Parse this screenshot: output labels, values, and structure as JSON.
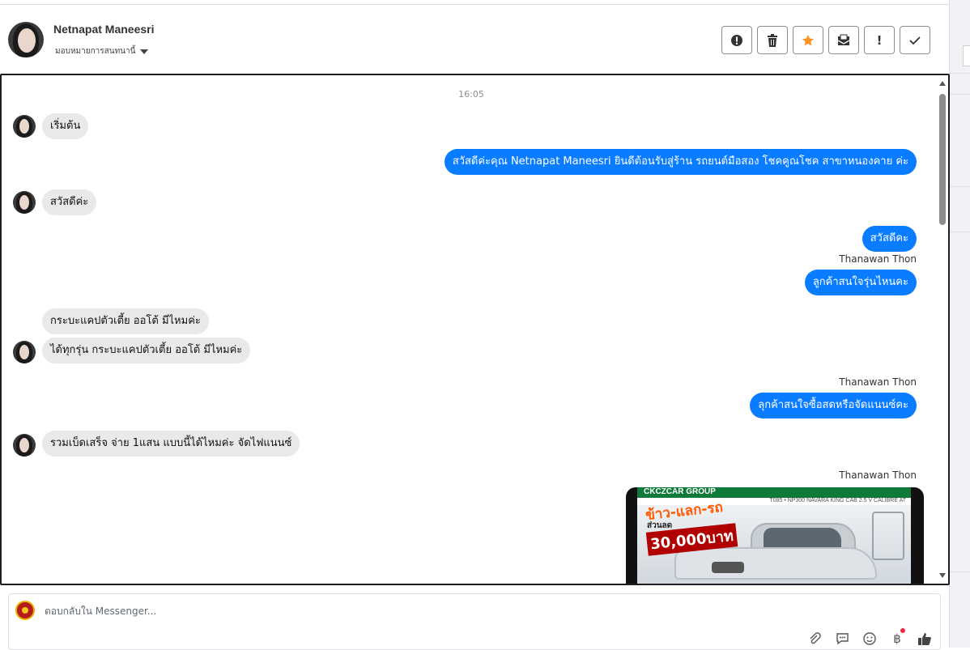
{
  "header": {
    "contact_name": "Netnapat Maneesri",
    "assign_label": "มอบหมายการสนทนานี้",
    "actions": [
      {
        "name": "spam-button",
        "icon": "alert-circle-icon"
      },
      {
        "name": "delete-button",
        "icon": "trash-icon"
      },
      {
        "name": "star-button",
        "icon": "star-icon",
        "color": "#f7931e"
      },
      {
        "name": "mark-unread-button",
        "icon": "envelope-icon"
      },
      {
        "name": "follow-up-button",
        "icon": "exclamation-icon"
      },
      {
        "name": "done-button",
        "icon": "check-icon"
      }
    ]
  },
  "conversation": {
    "time": "16:05",
    "messages": {
      "m1": "เริ่มต้น",
      "m2": "สวัสดีค่ะคุณ Netnapat Maneesri ยินดีต้อนรับสู่ร้าน รถยนต์มือสอง โชคคูณโชค สาขาหนองคาย ค่ะ",
      "m3": "สวัสดีค่ะ",
      "m4": "สวัสดีคะ",
      "m4_sender": "Thanawan Thon",
      "m5": "ลูกค้าสนใจรุ่นไหนคะ",
      "m6": "กระบะแคปตัวเตี้ย ออโต้ มีไหมค่ะ",
      "m7": "ได้ทุกรุ่น กระบะแคปตัวเตี้ย ออโต้ มีไหมค่ะ",
      "m8_sender": "Thanawan Thon",
      "m8": "ลุกค้าสนใจซื้อสดหรือจัดแนนซ์คะ",
      "m9": "รวมเบ็ดเสร็จ   จ่าย 1แสน แบบนี้ได้ไหมค่ะ จัดไฟแนนซ์",
      "m10_sender": "Thanawan Thon"
    },
    "image_card": {
      "band_text": "CKCZCAR GROUP",
      "model_text": "T085 • NP300 NAVARA KING CAB 2.5 V CALIBRE AT",
      "promo_text": "ข้าว-แลก-รถ",
      "discount_label": "ส่วนลด",
      "discount_value": "30,000บาท"
    }
  },
  "composer": {
    "placeholder": "ตอบกลับใน Messenger...",
    "tools": [
      "paperclip-icon",
      "chat-icon",
      "emoji-icon",
      "baht-icon",
      "thumbs-up-icon"
    ],
    "baht_symbol": "฿"
  },
  "colors": {
    "outgoing_bubble": "#0a7cff",
    "incoming_bubble": "#e9e9e9",
    "star": "#f7931e",
    "badge": "#f02849"
  }
}
